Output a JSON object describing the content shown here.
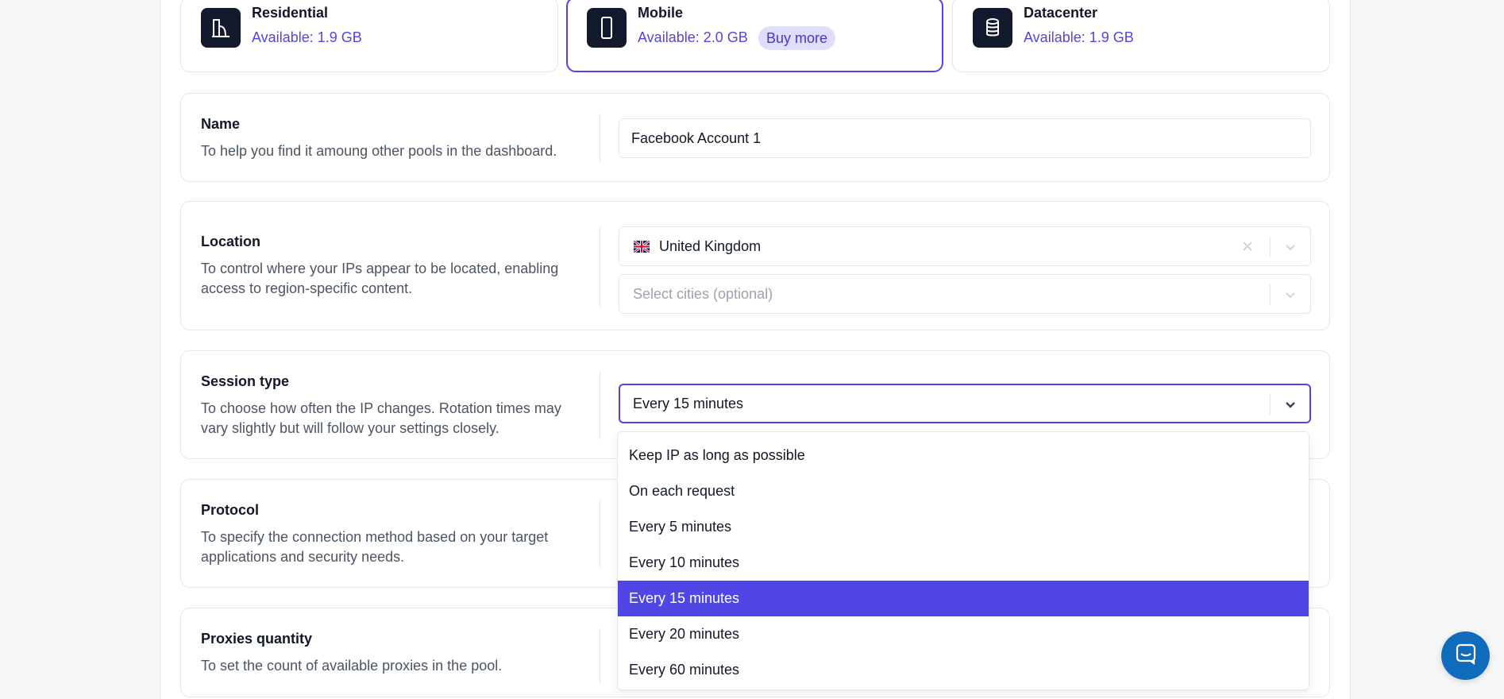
{
  "products": [
    {
      "name": "Residential",
      "available": "Available: 1.9 GB",
      "icon": "building-icon",
      "selected": false
    },
    {
      "name": "Mobile",
      "available": "Available: 2.0 GB",
      "icon": "mobile-phone-icon",
      "selected": true,
      "action": "Buy more"
    },
    {
      "name": "Datacenter",
      "available": "Available: 1.9 GB",
      "icon": "database-icon",
      "selected": false
    }
  ],
  "name_section": {
    "title": "Name",
    "description": "To help you find it amoung other pools in the dashboard.",
    "value": "Facebook Account 1"
  },
  "location_section": {
    "title": "Location",
    "description": "To control where your IPs appear to be located, enabling access to region-specific content.",
    "country": "United Kingdom",
    "country_flag": "uk-flag-icon",
    "cities_placeholder": "Select cities (optional)"
  },
  "session_section": {
    "title": "Session type",
    "description": "To choose how often the IP changes. Rotation times may vary slightly but will follow your settings closely.",
    "selected": "Every 15 minutes",
    "options": [
      "Keep IP as long as possible",
      "On each request",
      "Every 5 minutes",
      "Every 10 minutes",
      "Every 15 minutes",
      "Every 20 minutes",
      "Every 60 minutes"
    ]
  },
  "protocol_section": {
    "title": "Protocol",
    "description": "To specify the connection method based on your target applications and security needs."
  },
  "quantity_section": {
    "title": "Proxies quantity",
    "description": "To set the count of available proxies in the pool."
  },
  "colors": {
    "accent": "#4f46e5",
    "icon_bg": "#141a2e",
    "chat": "#0f6cbd"
  }
}
